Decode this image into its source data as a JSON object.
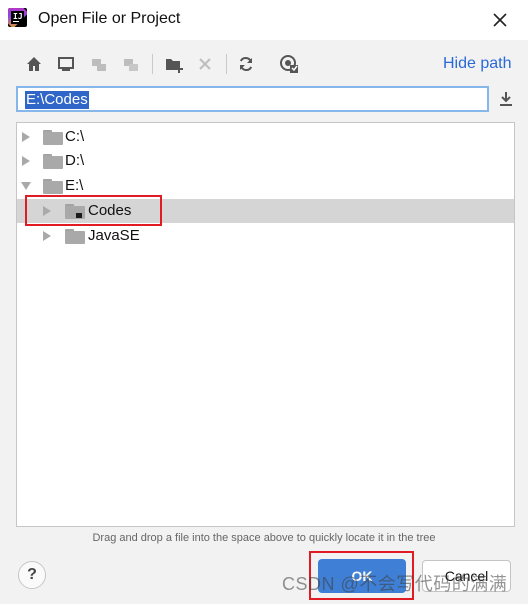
{
  "window": {
    "title": "Open File or Project"
  },
  "toolbar": {
    "icons": [
      "home-icon",
      "desktop-icon",
      "project-icon",
      "module-icon",
      "new-folder-icon",
      "delete-icon",
      "refresh-icon",
      "show-hidden-icon"
    ],
    "hide_path_label": "Hide path"
  },
  "path_field": {
    "value": "E:\\Codes"
  },
  "tree": {
    "rows": [
      {
        "label": "C:\\",
        "level": 0,
        "expanded": false
      },
      {
        "label": "D:\\",
        "level": 0,
        "expanded": false
      },
      {
        "label": "E:\\",
        "level": 0,
        "expanded": true
      },
      {
        "label": "Codes",
        "level": 1,
        "expanded": false,
        "selected": true
      },
      {
        "label": "JavaSE",
        "level": 1,
        "expanded": false
      }
    ]
  },
  "hint": "Drag and drop a file into the space above to quickly locate it in the tree",
  "buttons": {
    "help": "?",
    "ok": "OK",
    "cancel": "Cancel"
  },
  "watermark": "CSDN @不会写代码的满满",
  "colors": {
    "accent": "#3f80d6",
    "link": "#2a6ad6",
    "selection": "#d5d5d5",
    "highlight_box": "#e01b24"
  }
}
